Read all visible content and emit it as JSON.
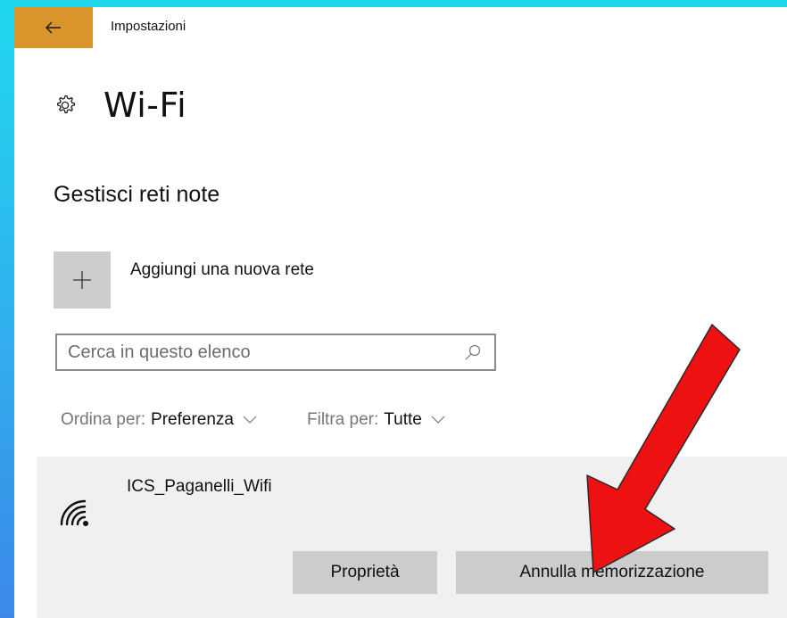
{
  "window": {
    "title": "Impostazioni",
    "back_icon": "back-arrow-icon",
    "accent": "#d9942c"
  },
  "page": {
    "title": "Wi-Fi",
    "icon": "gear-icon"
  },
  "section": {
    "title": "Gestisci reti note"
  },
  "add_network": {
    "label": "Aggiungi una nuova rete",
    "icon": "plus-icon"
  },
  "search": {
    "placeholder": "Cerca in questo elenco",
    "value": "",
    "icon": "search-icon"
  },
  "sort": {
    "label": "Ordina per:",
    "value": "Preferenza"
  },
  "filter": {
    "label": "Filtra per:",
    "value": "Tutte"
  },
  "networks": [
    {
      "name": "ICS_Paganelli_Wifi",
      "icon": "wifi-signal-icon",
      "buttons": {
        "properties": "Proprietà",
        "forget": "Annulla memorizzazione"
      }
    }
  ],
  "annotation": {
    "arrow_color": "#ee1111",
    "icon": "red-arrow-annotation"
  }
}
